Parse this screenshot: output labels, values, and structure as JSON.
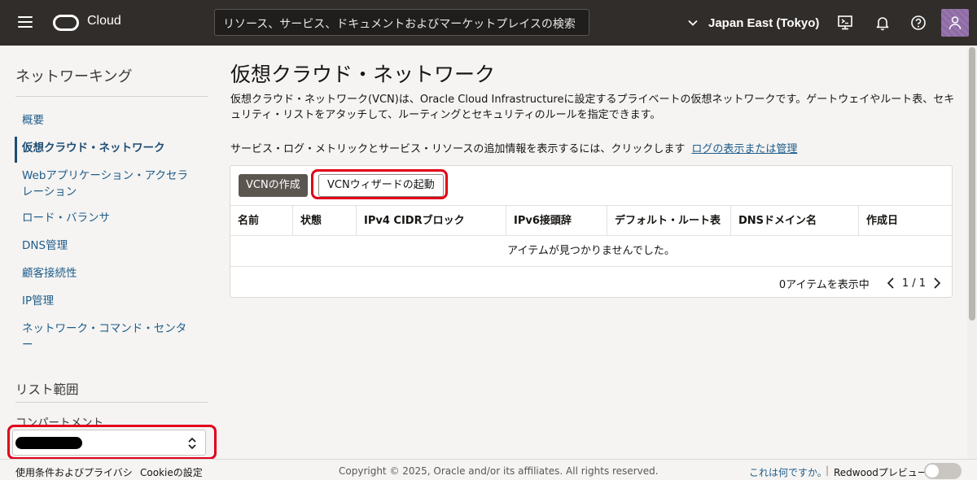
{
  "topbar": {
    "brand": "Cloud",
    "search_placeholder": "リソース、サービス、ドキュメントおよびマーケットプレイスの検索",
    "region": "Japan East (Tokyo)"
  },
  "sidebar": {
    "title": "ネットワーキング",
    "items": [
      {
        "label": "概要"
      },
      {
        "label": "仮想クラウド・ネットワーク",
        "active": true
      },
      {
        "label": "Webアプリケーション・アクセラレーション"
      },
      {
        "label": "ロード・バランサ"
      },
      {
        "label": "DNS管理"
      },
      {
        "label": "顧客接続性"
      },
      {
        "label": "IP管理"
      },
      {
        "label": "ネットワーク・コマンド・センター"
      }
    ],
    "scope_title": "リスト範囲",
    "compartment_label": "コンパートメント"
  },
  "main": {
    "title": "仮想クラウド・ネットワーク",
    "description": "仮想クラウド・ネットワーク(VCN)は、Oracle Cloud Infrastructureに設定するプライベートの仮想ネットワークです。ゲートウェイやルート表、セキュリティ・リストをアタッチして、ルーティングとセキュリティのルールを指定できます。",
    "log_text": "サービス・ログ・メトリックとサービス・リソースの追加情報を表示するには、クリックします",
    "log_link": "ログの表示または管理",
    "create_button": "VCNの作成",
    "wizard_button": "VCNウィザードの起動",
    "table": {
      "columns": [
        "名前",
        "状態",
        "IPv4 CIDRブロック",
        "IPv6接頭辞",
        "デフォルト・ルート表",
        "DNSドメイン名",
        "作成日"
      ],
      "empty_message": "アイテムが見つかりませんでした。"
    },
    "pager": {
      "count": "0アイテムを表示中",
      "page": "1 / 1"
    }
  },
  "footer": {
    "terms": "使用条件およびプライバシ",
    "cookie": "Cookieの設定",
    "copyright": "Copyright © 2025, Oracle and/or its affiliates. All rights reserved.",
    "whatis": "これは何ですか。",
    "separator": "|",
    "redwood": "Redwoodプレビュー"
  },
  "colors": {
    "topbar": "#312d2a",
    "link": "#1f5c8a",
    "highlight": "#e1001a",
    "create_button": "#5c5651"
  }
}
